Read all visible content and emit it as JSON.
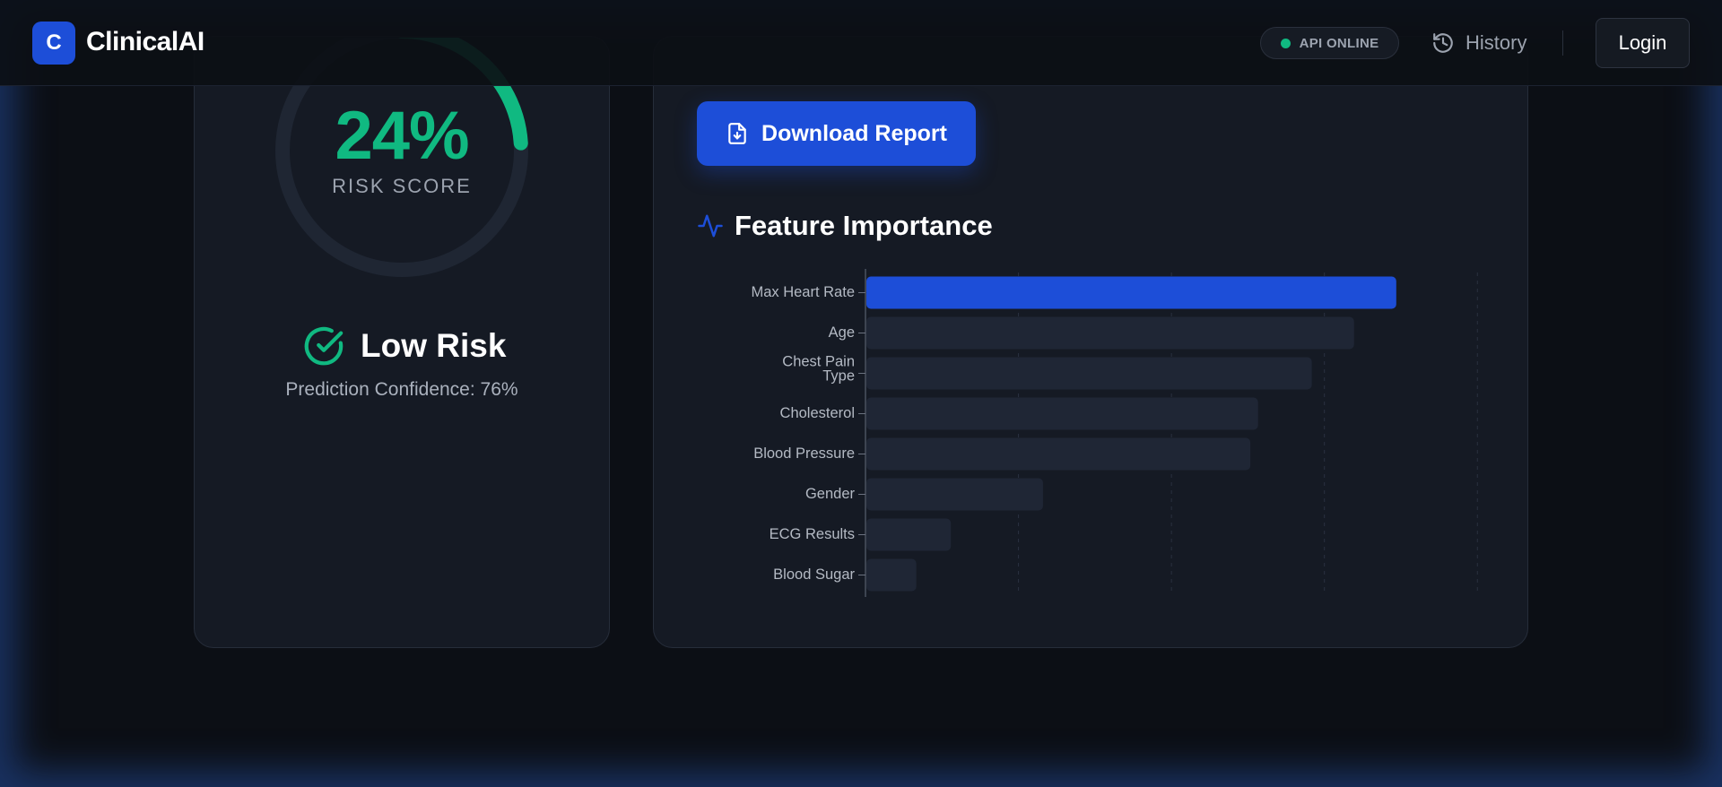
{
  "header": {
    "logo_letter": "C",
    "app_name": "ClinicalAI",
    "api_status": "API ONLINE",
    "history_label": "History",
    "login_label": "Login"
  },
  "result": {
    "risk_percent": "24%",
    "risk_score_label": "RISK SCORE",
    "risk_level": "Low Risk",
    "confidence": "Prediction Confidence: 76%"
  },
  "actions": {
    "download_label": "Download Report"
  },
  "feature_importance": {
    "title": "Feature Importance"
  },
  "colors": {
    "accent": "#1d4ed8",
    "success": "#10b981",
    "bar_muted": "#1f2635"
  },
  "chart_data": {
    "type": "bar",
    "orientation": "horizontal",
    "categories": [
      "Max Heart Rate",
      "Age",
      "Chest Pain Type",
      "Cholesterol",
      "Blood Pressure",
      "Gender",
      "ECG Results",
      "Blood Sugar"
    ],
    "values": [
      0.69,
      0.635,
      0.58,
      0.51,
      0.5,
      0.23,
      0.11,
      0.065
    ],
    "xlim": [
      0,
      0.8
    ],
    "grid": true,
    "highlight_index": 0
  }
}
